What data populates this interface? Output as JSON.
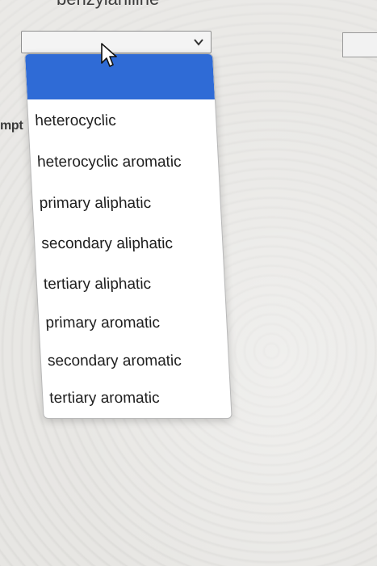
{
  "page": {
    "top_heading": "benzylaniline",
    "side_label": "mpt"
  },
  "select": {
    "selected_value": "",
    "options": [
      "",
      "heterocyclic",
      "heterocyclic aromatic",
      "primary aliphatic",
      "secondary aliphatic",
      "tertiary aliphatic",
      "primary aromatic",
      "secondary aromatic",
      "tertiary aromatic"
    ],
    "highlighted_option": 0
  },
  "colors": {
    "highlight": "#2f6bd6",
    "menu_background": "#ffffff",
    "text": "#1f1f1f"
  },
  "icons": {
    "select_arrow": "chevron-down-icon",
    "cursor": "mouse-pointer-icon"
  }
}
